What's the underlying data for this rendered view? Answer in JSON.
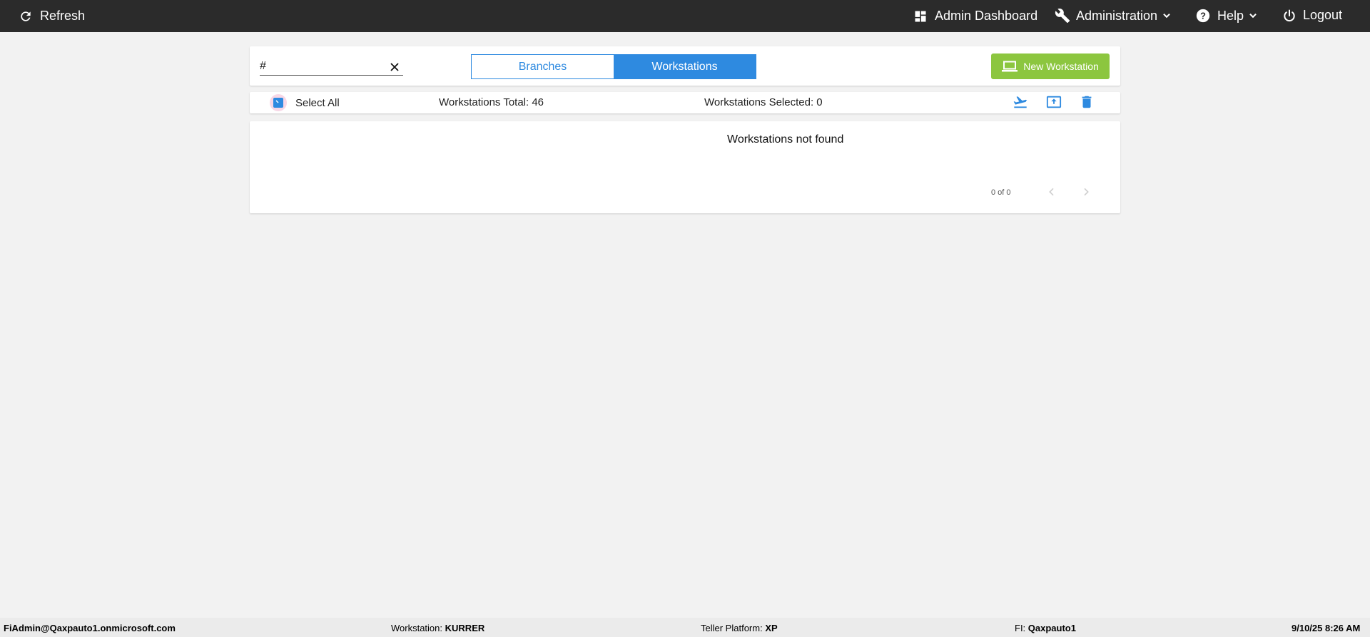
{
  "topbar": {
    "refresh_label": "Refresh",
    "admin_dashboard_label": "Admin Dashboard",
    "administration_label": "Administration",
    "help_label": "Help",
    "logout_label": "Logout",
    "background": "#2b2b2b"
  },
  "toolbar": {
    "search_value": "#",
    "tabs": [
      {
        "label": "Branches",
        "active": false
      },
      {
        "label": "Workstations",
        "active": true
      }
    ],
    "new_workstation_label": "New Workstation",
    "accent": "#2e8ae0",
    "new_button_color": "#8cc63f"
  },
  "selection": {
    "select_all_label": "Select All",
    "select_all_checked": true,
    "total_text": "Workstations Total: 46",
    "selected_text": "Workstations Selected: 0",
    "actions": [
      "depart-icon",
      "upload-icon",
      "trash-icon"
    ]
  },
  "list": {
    "empty_message": "Workstations not found",
    "pager_text": "0 of 0"
  },
  "footer": {
    "user": "FiAdmin@Qaxpauto1.onmicrosoft.com",
    "workstation_label": "Workstation:",
    "workstation_value": "KURRER",
    "teller_platform_label": "Teller Platform:",
    "teller_platform_value": "XP",
    "fi_label": "FI:",
    "fi_value": "Qaxpauto1",
    "datetime": "9/10/25 8:26 AM"
  }
}
